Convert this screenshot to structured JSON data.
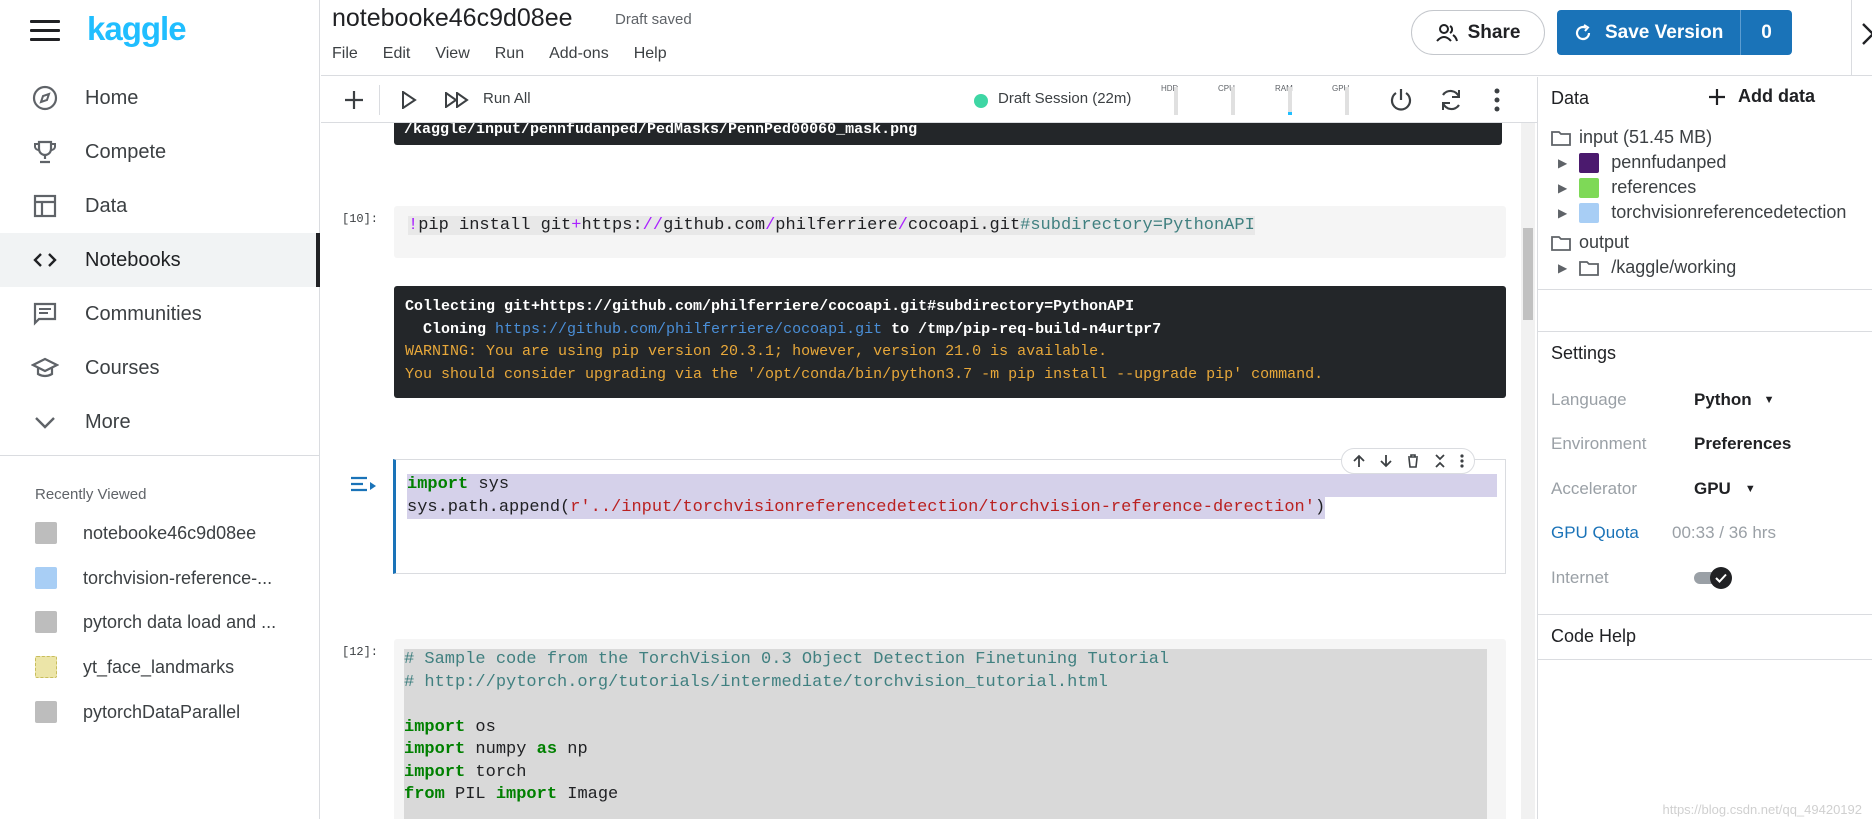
{
  "brand": {
    "logo": "kaggle"
  },
  "nav": {
    "items": [
      {
        "label": "Home",
        "icon": "compass-icon"
      },
      {
        "label": "Compete",
        "icon": "trophy-icon"
      },
      {
        "label": "Data",
        "icon": "table-icon"
      },
      {
        "label": "Notebooks",
        "icon": "code-icon",
        "active": true
      },
      {
        "label": "Communities",
        "icon": "chat-icon"
      },
      {
        "label": "Courses",
        "icon": "school-icon"
      },
      {
        "label": "More",
        "icon": "chevron-down-icon"
      }
    ],
    "recent_title": "Recently Viewed",
    "recent": [
      {
        "label": "notebooke46c9d08ee",
        "thumb": "#bdbdbd"
      },
      {
        "label": "torchvision-reference-...",
        "thumb": "#a8cef5"
      },
      {
        "label": "pytorch data load and ...",
        "thumb": "#bdbdbd"
      },
      {
        "label": "yt_face_landmarks",
        "thumb": "#e6e0a0"
      },
      {
        "label": "pytorchDataParallel",
        "thumb": "#bdbdbd"
      }
    ]
  },
  "header": {
    "title": "notebooke46c9d08ee",
    "status": "Draft saved",
    "menu": [
      "File",
      "Edit",
      "View",
      "Run",
      "Add-ons",
      "Help"
    ],
    "share_label": "Share",
    "save_label": "Save Version",
    "save_count": "0"
  },
  "toolbar": {
    "run_all": "Run All",
    "session": "Draft Session (22m)",
    "meters": [
      {
        "label": "HDD",
        "fill": 0
      },
      {
        "label": "CPU",
        "fill": 0
      },
      {
        "label": "RAM",
        "fill": 0.1
      },
      {
        "label": "GPU",
        "fill": 0
      }
    ]
  },
  "cells": {
    "prev_output": "/kaggle/input/pennfudanped/PedMasks/PennPed00060_mask.png",
    "c10_num": "[10]:",
    "c10_code": {
      "bang": "!",
      "cmd": "pip install git",
      "plus": "+",
      "url1": "https:",
      "sl1": "//",
      "url2": "github.com",
      "sl2": "/",
      "url3": "philferriere",
      "sl3": "/",
      "url4": "cocoapi.git",
      "frag": "#subdirectory=PythonAPI"
    },
    "c10_out": {
      "l1": "Collecting git+https://github.com/philferriere/cocoapi.git#subdirectory=PythonAPI",
      "l2a": "  Cloning ",
      "l2link": "https://github.com/philferriere/cocoapi.git",
      "l2b": " to /tmp/pip-req-build-n4urtpr7",
      "l3": "WARNING: You are using pip version 20.3.1; however, version 21.0 is available.",
      "l4": "You should consider upgrading via the '/opt/conda/bin/python3.7 -m pip install --upgrade pip' command."
    },
    "c11_code": {
      "import": "import",
      "sys": " sys",
      "append": "sys.path.append(",
      "str": "r'../input/torchvisionreferencedetection/torchvision-reference-derection'",
      "close": ")"
    },
    "c12_num": "[12]:",
    "c12_lines": {
      "cm1": "# Sample code from the TorchVision 0.3 Object Detection Finetuning Tutorial",
      "cm2": "# http://pytorch.org/tutorials/intermediate/torchvision_tutorial.html",
      "i1k": "import",
      "i1": " os",
      "i2k": "import",
      "i2": " numpy ",
      "i2as": "as",
      "i2b": " np",
      "i3k": "import",
      "i3": " torch",
      "i4k": "from",
      "i4": " PIL ",
      "i4imp": "import",
      "i4b": " Image"
    }
  },
  "panel": {
    "data_title": "Data",
    "add_data": "Add data",
    "input": "input (51.45 MB)",
    "datasets": [
      "pennfudanped",
      "references",
      "torchvisionreferencedetection"
    ],
    "output": "output",
    "working": "/kaggle/working",
    "settings_title": "Settings",
    "language_k": "Language",
    "language_v": "Python",
    "environment_k": "Environment",
    "environment_v": "Preferences",
    "accelerator_k": "Accelerator",
    "accelerator_v": "GPU",
    "quota_k": "GPU Quota",
    "quota_v": "00:33 / 36 hrs",
    "internet_k": "Internet",
    "internet_on": true,
    "code_help": "Code Help"
  },
  "watermark": "https://blog.csdn.net/qq_49420192",
  "colors": {
    "accent": "#20beff",
    "save": "#1a73b8",
    "session": "#3ed6a4"
  }
}
